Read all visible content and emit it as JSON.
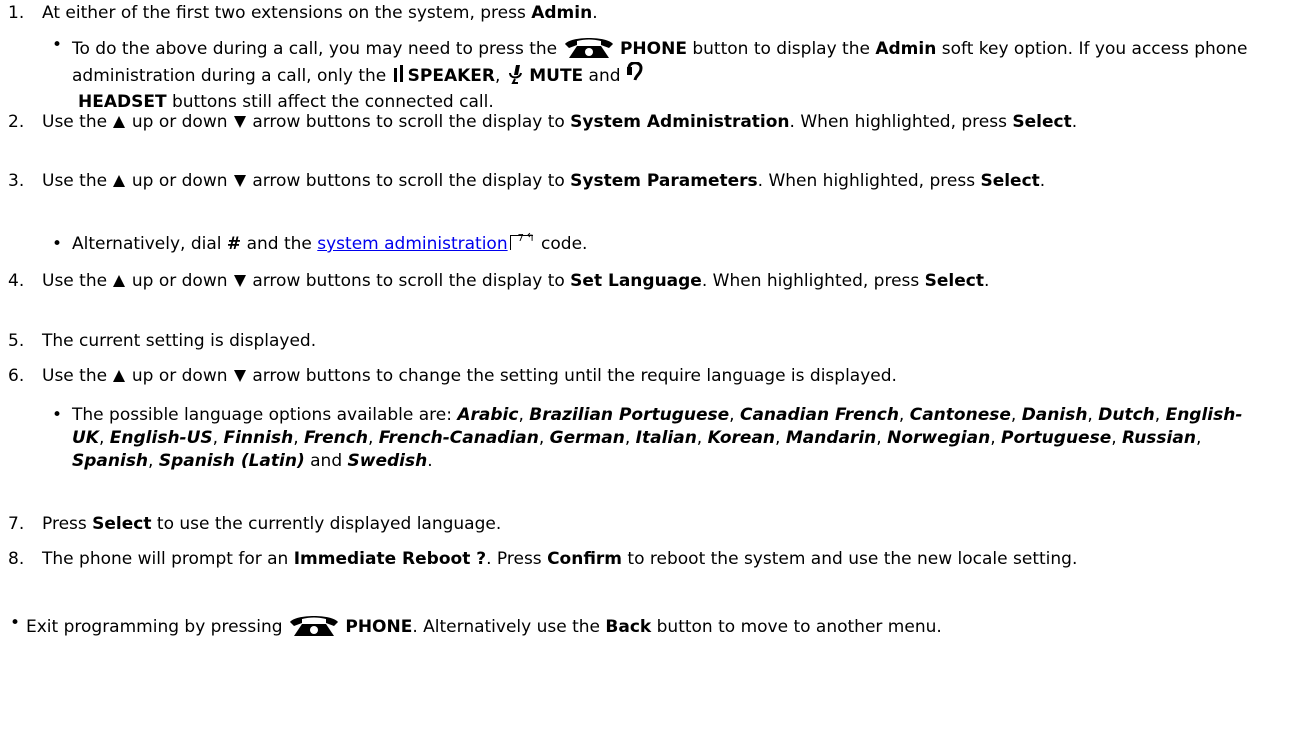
{
  "steps": [
    {
      "number": "1.",
      "parts": [
        "At either of the first two extensions on the system, press ",
        "Admin",
        "."
      ]
    },
    {
      "number": "2.",
      "parts": [
        "Use the ",
        " up or down ",
        " arrow buttons to scroll the display to ",
        "System Administration",
        ". When highlighted, press ",
        "Select",
        "."
      ]
    },
    {
      "number": "3.",
      "parts": [
        "Use the ",
        " up or down ",
        " arrow buttons to scroll the display to ",
        "System Parameters",
        ". When highlighted, press ",
        "Select",
        "."
      ]
    },
    {
      "number": "4.",
      "parts": [
        "Use the ",
        " up or down ",
        " arrow buttons to scroll the display to ",
        "Set Language",
        ". When highlighted, press ",
        "Select",
        "."
      ]
    },
    {
      "number": "5.",
      "parts": [
        "The current setting is displayed."
      ]
    },
    {
      "number": "6.",
      "parts": [
        "Use the ",
        " up or down ",
        " arrow buttons to change the setting until the require language is displayed."
      ]
    },
    {
      "number": "7.",
      "parts": [
        "Press ",
        "Select",
        " to use the currently displayed language."
      ]
    },
    {
      "number": "8.",
      "parts": [
        "The phone will prompt for an ",
        "Immediate Reboot ?",
        ". Press ",
        "Confirm",
        " to reboot the system and use the new locale setting."
      ]
    }
  ],
  "sub1": {
    "parts": [
      "To do the above during a call, you may need to press the ",
      "PHONE",
      " button to display the ",
      "Admin",
      " soft key option. If you access phone administration during a call, only the ",
      "SPEAKER",
      ", ",
      "MUTE",
      " and ",
      "HEADSET",
      " buttons still affect the connected call."
    ]
  },
  "sub3": {
    "parts": [
      "Alternatively, dial ",
      "#",
      " and the ",
      "system administration",
      "7",
      " code."
    ]
  },
  "sub6": {
    "intro": "The possible language options available are: ",
    "languages": [
      "Arabic",
      "Brazilian Portuguese",
      "Canadian French",
      "Cantonese",
      "Danish",
      "Dutch",
      "English-UK",
      "English-US",
      "Finnish",
      "French",
      "French-Canadian",
      "German",
      "Italian",
      "Korean",
      "Mandarin",
      "Norwegian",
      "Portuguese",
      "Russian",
      "Spanish",
      "Spanish (Latin)",
      "Swedish"
    ],
    "sep": ", ",
    "and": " and ",
    "end": "."
  },
  "final": {
    "parts": [
      "Exit programming by pressing ",
      "PHONE",
      ". Alternatively use the ",
      "Back",
      " button to move to another menu."
    ]
  },
  "colors": {
    "link": "#0000ee",
    "text": "#000000"
  },
  "icons": [
    "phone-icon",
    "speaker-icon",
    "mute-icon",
    "headset-icon",
    "up-arrow-icon",
    "down-arrow-icon",
    "cross-reference-icon"
  ]
}
